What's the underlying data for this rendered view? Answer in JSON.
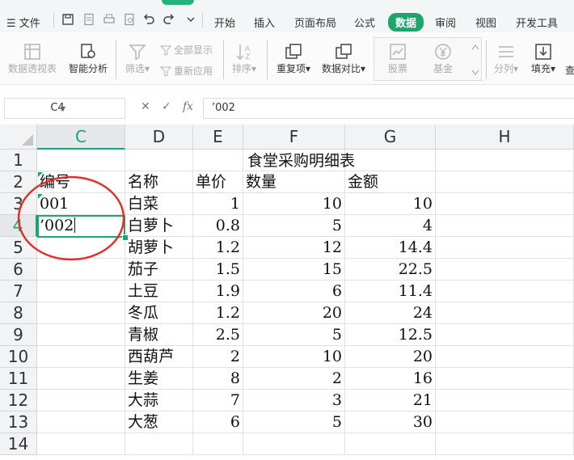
{
  "menu": {
    "file_label": "文件",
    "tabs": [
      "开始",
      "插入",
      "页面布局",
      "公式",
      "数据",
      "审阅",
      "视图",
      "开发工具"
    ],
    "active_tab": "数据"
  },
  "ribbon": {
    "pivot": "数据透视表",
    "smart_analysis": "智能分析",
    "filter": "筛选",
    "show_all": "全部显示",
    "reapply": "重新应用",
    "sort": "排序",
    "duplicates": "重复项",
    "compare": "数据对比",
    "stocks": "股票",
    "funds": "基金",
    "split": "分列",
    "fill": "填充",
    "overflow": "查"
  },
  "formula_bar": {
    "cell_ref": "C4",
    "fx": "fx",
    "content": "’002"
  },
  "sheet": {
    "columns": [
      "C",
      "D",
      "E",
      "F",
      "G",
      "H"
    ],
    "selected_column": "C",
    "rows": [
      "1",
      "2",
      "3",
      "4",
      "5",
      "6",
      "7",
      "8",
      "9",
      "10",
      "11",
      "12",
      "13",
      "14"
    ],
    "selected_row": "4",
    "title": "食堂采购明细表",
    "headers": {
      "id": "编号",
      "name": "名称",
      "price": "单价",
      "qty": "数量",
      "amount": "金额"
    },
    "ids": [
      "001",
      "’002"
    ],
    "items": [
      {
        "name": "白菜",
        "price": "1",
        "qty": "10",
        "amount": "10"
      },
      {
        "name": "白萝卜",
        "price": "0.8",
        "qty": "5",
        "amount": "4"
      },
      {
        "name": "胡萝卜",
        "price": "1.2",
        "qty": "12",
        "amount": "14.4"
      },
      {
        "name": "茄子",
        "price": "1.5",
        "qty": "15",
        "amount": "22.5"
      },
      {
        "name": "土豆",
        "price": "1.9",
        "qty": "6",
        "amount": "11.4"
      },
      {
        "name": "冬瓜",
        "price": "1.2",
        "qty": "20",
        "amount": "24"
      },
      {
        "name": "青椒",
        "price": "2.5",
        "qty": "5",
        "amount": "12.5"
      },
      {
        "name": "西葫芦",
        "price": "2",
        "qty": "10",
        "amount": "20"
      },
      {
        "name": "生姜",
        "price": "8",
        "qty": "2",
        "amount": "16"
      },
      {
        "name": "大蒜",
        "price": "7",
        "qty": "3",
        "amount": "21"
      },
      {
        "name": "大葱",
        "price": "6",
        "qty": "5",
        "amount": "30"
      }
    ]
  },
  "colors": {
    "accent": "#1ea46c",
    "annotation": "#d9342b"
  }
}
